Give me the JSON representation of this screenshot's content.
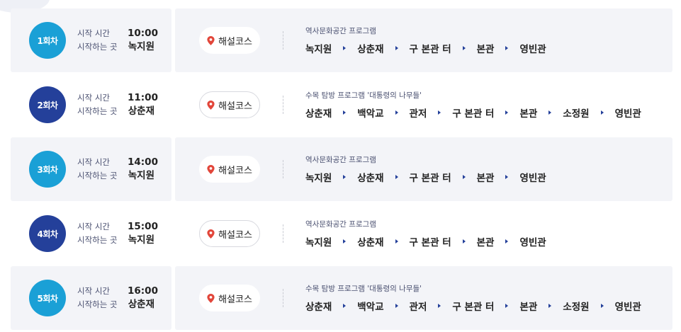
{
  "colors": {
    "badge_light": "#1aa0d6",
    "badge_dark": "#24409a",
    "pin": "#e2463a"
  },
  "labels": {
    "start_time": "시작 시간",
    "start_place": "시작하는 곳"
  },
  "course_label": "해설코스",
  "rows": [
    {
      "badge": "1회차",
      "badge_color": "light",
      "shaded": true,
      "time": "10:00",
      "place": "녹지원",
      "program": "역사문화공간 프로그램",
      "route": [
        "녹지원",
        "상춘재",
        "구 본관 터",
        "본관",
        "영빈관"
      ]
    },
    {
      "badge": "2회차",
      "badge_color": "dark",
      "shaded": false,
      "time": "11:00",
      "place": "상춘재",
      "program": "수목 탐방 프로그램 '대통령의 나무들'",
      "route": [
        "상춘재",
        "백악교",
        "관저",
        "구 본관 터",
        "본관",
        "소정원",
        "영빈관"
      ]
    },
    {
      "badge": "3회차",
      "badge_color": "light",
      "shaded": true,
      "time": "14:00",
      "place": "녹지원",
      "program": "역사문화공간 프로그램",
      "route": [
        "녹지원",
        "상춘재",
        "구 본관 터",
        "본관",
        "영빈관"
      ]
    },
    {
      "badge": "4회차",
      "badge_color": "dark",
      "shaded": false,
      "time": "15:00",
      "place": "녹지원",
      "program": "역사문화공간 프로그램",
      "route": [
        "녹지원",
        "상춘재",
        "구 본관 터",
        "본관",
        "영빈관"
      ]
    },
    {
      "badge": "5회차",
      "badge_color": "light",
      "shaded": true,
      "time": "16:00",
      "place": "상춘재",
      "program": "수목 탐방 프로그램 '대통령의 나무들'",
      "route": [
        "상춘재",
        "백악교",
        "관저",
        "구 본관 터",
        "본관",
        "소정원",
        "영빈관"
      ]
    }
  ]
}
